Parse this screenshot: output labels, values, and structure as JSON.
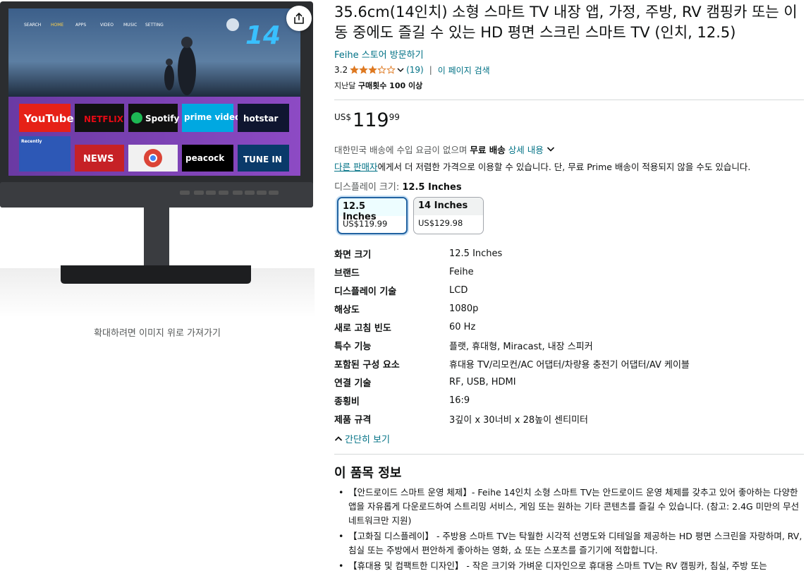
{
  "image": {
    "menu_items": [
      "SEARCH",
      "HOME",
      "APPS",
      "VIDEO",
      "MUSIC",
      "SETTING"
    ],
    "badge": "14",
    "app_tiles": [
      "YouTube",
      "NETFLIX",
      "Spotify",
      "prime video",
      "hotstar",
      "Recently",
      "BBC NEWS",
      "chrome",
      "peacock",
      "TUNE IN"
    ],
    "zoom_hint": "확대하려면 이미지 위로 가져가기"
  },
  "product": {
    "title": "35.6cm(14인치) 소형 스마트 TV 내장 앱, 가정, 주방, RV 캠핑카 또는 이동 중에도 즐길 수 있는 HD 평면 스크린 스마트 TV (인치, 12.5)",
    "store_link": "Feihe 스토어 방문하기",
    "rating": "3.2",
    "rating_count": "(19)",
    "rating_stars_value": 3.2,
    "search_page": "이 페이지 검색",
    "bought_prefix": "지난달",
    "bought_bold": "구매횟수 100 이상"
  },
  "price": {
    "symbol": "US$",
    "whole": "119",
    "fraction": "99"
  },
  "shipping": {
    "text": "대한민국 배송에 수입 요금이 없으며",
    "bold": "무료 배송",
    "details": "상세 내용",
    "other_link": "다른 판매자",
    "other_text": "에게서 더 저렴한 가격으로 이용할 수 있습니다. 단, 무료 Prime 배송이 적용되지 않을 수도 있습니다."
  },
  "size": {
    "label": "디스플레이 크기:",
    "selected": "12.5 Inches",
    "options": [
      {
        "name": "12.5 Inches",
        "price": "US$119.99"
      },
      {
        "name": "14 Inches",
        "price": "US$129.98"
      }
    ]
  },
  "specs": [
    {
      "key": "화면 크기",
      "value": "12.5 Inches"
    },
    {
      "key": "브랜드",
      "value": "Feihe"
    },
    {
      "key": "디스플레이 기술",
      "value": "LCD"
    },
    {
      "key": "해상도",
      "value": "1080p"
    },
    {
      "key": "새로 고침 빈도",
      "value": "60 Hz"
    },
    {
      "key": "특수 기능",
      "value": "플랫, 휴대형, Miracast, 내장 스피커"
    },
    {
      "key": "포함된 구성 요소",
      "value": "휴대용 TV/리모컨/AC 어댑터/차량용 충전기 어댑터/AV 케이블"
    },
    {
      "key": "연결 기술",
      "value": "RF, USB, HDMI"
    },
    {
      "key": "종횡비",
      "value": "16:9"
    },
    {
      "key": "제품 규격",
      "value": "3깊이 x 30너비 x 28높이 센티미터"
    }
  ],
  "collapse_label": "간단히 보기",
  "about": {
    "title": "이 품목 정보",
    "bullets": [
      "【안드로이드 스마트 운영 체제】- Feihe 14인치 소형 스마트 TV는 안드로이드 운영 체제를 갖추고 있어 좋아하는 다양한 앱을 자유롭게 다운로드하여 스트리밍 서비스, 게임 또는 원하는 기타 콘텐츠를 즐길 수 있습니다. (참고: 2.4G 미만의 무선 네트워크만 지원)",
      "【고화질 디스플레이】 - 주방용 스마트 TV는 탁월한 시각적 선명도와 디테일을 제공하는 HD 평면 스크린을 자랑하며, RV, 침실 또는 주방에서 편안하게 좋아하는 영화, 쇼 또는 스포츠를 즐기기에 적합합니다.",
      "【휴대용 및 컴팩트한 디자인】 - 작은 크기와 가벼운 디자인으로 휴대용 스마트 TV는 RV 캠핑카, 침실, 주방 또는"
    ]
  },
  "colors": {
    "link": "#007185",
    "star": "#de7921",
    "selected_border": "#2162a1"
  }
}
